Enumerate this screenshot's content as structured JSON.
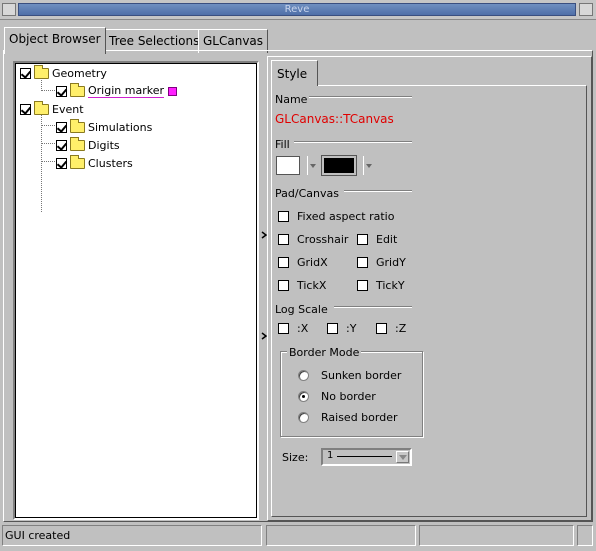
{
  "window": {
    "title": "Reve"
  },
  "tabs": [
    {
      "label": "Object Browser",
      "active": true
    },
    {
      "label": "Tree Selections",
      "active": false
    },
    {
      "label": "GLCanvas",
      "active": false
    }
  ],
  "tree": [
    {
      "label": "Geometry",
      "checked": true,
      "level": 0,
      "icon": "folder-icon"
    },
    {
      "label": "Origin marker",
      "checked": true,
      "level": 1,
      "icon": "folder-icon",
      "color": "#ff20ff"
    },
    {
      "label": "Event",
      "checked": true,
      "level": 0,
      "icon": "folder-icon"
    },
    {
      "label": "Simulations",
      "checked": true,
      "level": 1,
      "icon": "folder-icon"
    },
    {
      "label": "Digits",
      "checked": true,
      "level": 1,
      "icon": "folder-icon"
    },
    {
      "label": "Clusters",
      "checked": true,
      "level": 1,
      "icon": "folder-icon"
    }
  ],
  "editor": {
    "tab_label": "Style",
    "name_heading": "Name",
    "object_name": "GLCanvas::TCanvas",
    "object_name_color": "#e00000",
    "fill_heading": "Fill",
    "fill_color_1": "#ffffff",
    "fill_color_2": "#000000",
    "pad_heading": "Pad/Canvas",
    "fixed_aspect": {
      "label": "Fixed aspect ratio",
      "checked": false
    },
    "crosshair": {
      "label": "Crosshair",
      "checked": false
    },
    "edit": {
      "label": "Edit",
      "checked": false
    },
    "gridx": {
      "label": "GridX",
      "checked": false
    },
    "gridy": {
      "label": "GridY",
      "checked": false
    },
    "tickx": {
      "label": "TickX",
      "checked": false
    },
    "ticky": {
      "label": "TickY",
      "checked": false
    },
    "log_heading": "Log Scale",
    "logx": {
      "label": ":X",
      "checked": false
    },
    "logy": {
      "label": ":Y",
      "checked": false
    },
    "logz": {
      "label": ":Z",
      "checked": false
    },
    "border_heading": "Border Mode",
    "border_options": [
      {
        "label": "Sunken border",
        "selected": false
      },
      {
        "label": "No border",
        "selected": true
      },
      {
        "label": "Raised border",
        "selected": false
      }
    ],
    "size_label": "Size:",
    "size_value": "1"
  },
  "status": {
    "text": "GUI created"
  }
}
